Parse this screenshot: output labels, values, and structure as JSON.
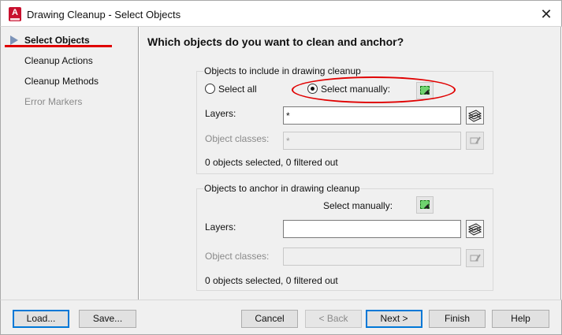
{
  "window": {
    "title": "Drawing Cleanup - Select Objects",
    "app_icon_letter": "A",
    "close_glyph": "✕"
  },
  "sidebar": {
    "items": [
      {
        "label": "Select Objects",
        "state": "active"
      },
      {
        "label": "Cleanup Actions",
        "state": "normal"
      },
      {
        "label": "Cleanup Methods",
        "state": "normal"
      },
      {
        "label": "Error Markers",
        "state": "disabled"
      }
    ]
  },
  "main": {
    "heading": "Which objects do you want to clean and anchor?",
    "include_group": {
      "title": "Objects to include in drawing cleanup",
      "select_all_label": "Select all",
      "select_manually_label": "Select manually:",
      "selected_option": "select_manually",
      "layers_label": "Layers:",
      "layers_value": "*",
      "object_classes_label": "Object classes:",
      "object_classes_value": "*",
      "status": "0 objects selected, 0 filtered out"
    },
    "anchor_group": {
      "title": "Objects to anchor in drawing cleanup",
      "select_manually_label": "Select manually:",
      "layers_label": "Layers:",
      "layers_value": "",
      "object_classes_label": "Object classes:",
      "object_classes_value": "",
      "status": "0 objects selected, 0 filtered out"
    }
  },
  "footer": {
    "load": "Load...",
    "save": "Save...",
    "cancel": "Cancel",
    "back": "< Back",
    "next": "Next >",
    "finish": "Finish",
    "help": "Help"
  },
  "colors": {
    "annotation_red": "#e00000",
    "focus_blue": "#0078d7",
    "icon_red": "#c8102e",
    "select_green": "#6fd36f"
  },
  "icons": {
    "app": "autocad-app-icon",
    "select_objects": "select-objects-icon",
    "layer_filter": "layer-filter-icon",
    "class_filter": "class-filter-icon",
    "nav_current": "triangle-right-icon"
  }
}
